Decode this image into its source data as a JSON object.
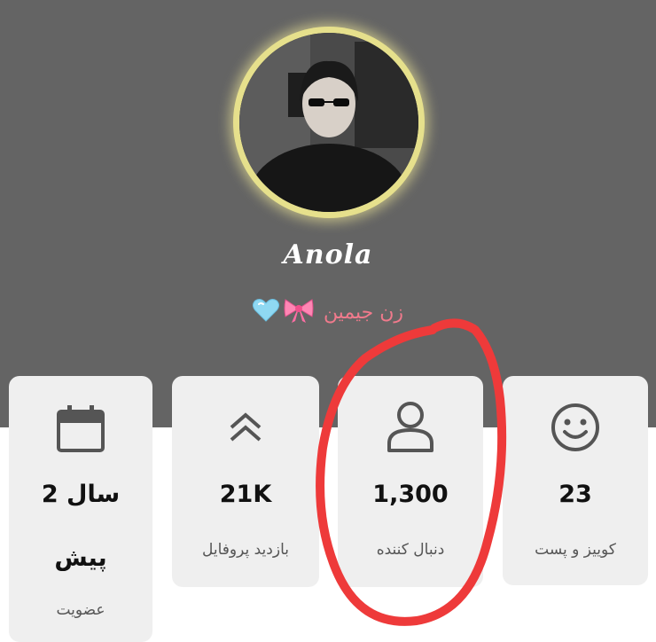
{
  "profile": {
    "username": "Anola",
    "bio_text": "زن جیمین",
    "bio_emojis": [
      "bow-emoji",
      "light-blue-heart-emoji"
    ]
  },
  "stats": [
    {
      "id": "posts",
      "icon": "smiley-icon",
      "value": "23",
      "label": "کوییز و پست"
    },
    {
      "id": "followers",
      "icon": "person-icon",
      "value": "1,300",
      "label": "دنبال کننده"
    },
    {
      "id": "profile-views",
      "icon": "double-chevron-up-icon",
      "value": "21K",
      "label": "بازدید پروفایل"
    },
    {
      "id": "membership",
      "icon": "calendar-icon",
      "value_line1": "2 سال",
      "value_line2": "پیش",
      "label": "عضویت"
    }
  ],
  "colors": {
    "header_bg": "#646464",
    "card_bg": "#efefef",
    "avatar_ring": "#e6e08c",
    "bio_text": "#f07a8c",
    "annotation_circle": "#ee3a3a"
  }
}
